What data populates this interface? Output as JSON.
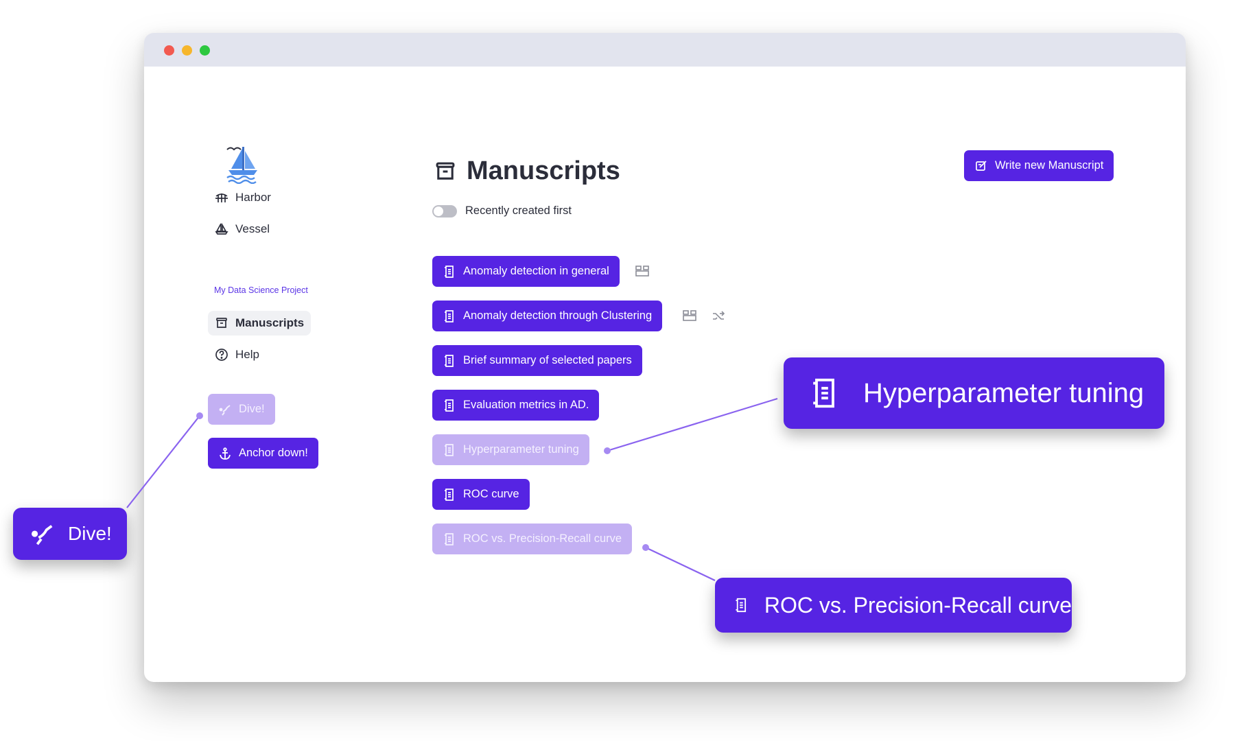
{
  "sidebar": {
    "nav": [
      {
        "label": "Harbor",
        "icon": "harbor-bridge-icon"
      },
      {
        "label": "Vessel",
        "icon": "sailboat-icon"
      }
    ],
    "project_label": "My Data Science Project",
    "nav2": [
      {
        "label": "Manuscripts",
        "icon": "archive-box-icon",
        "active": true
      },
      {
        "label": "Help",
        "icon": "question-circle-icon"
      }
    ],
    "dive_label": "Dive!",
    "anchor_label": "Anchor down!"
  },
  "header": {
    "title": "Manuscripts",
    "write_button_label": "Write new Manuscript",
    "toggle_label": "Recently created first",
    "toggle_on": false
  },
  "manuscripts": [
    {
      "label": "Anomaly detection in general",
      "state": "active",
      "extra_icons": [
        "layout-icon"
      ]
    },
    {
      "label": "Anomaly detection through Clustering",
      "state": "active",
      "extra_icons": [
        "layout-icon",
        "shuffle-icon"
      ]
    },
    {
      "label": "Brief summary of selected papers",
      "state": "active"
    },
    {
      "label": "Evaluation metrics in AD.",
      "state": "active"
    },
    {
      "label": "Hyperparameter tuning",
      "state": "faded"
    },
    {
      "label": "ROC curve",
      "state": "active"
    },
    {
      "label": "ROC vs. Precision-Recall curve",
      "state": "faded"
    }
  ],
  "callouts": {
    "dive": "Dive!",
    "hyperparameter": "Hyperparameter tuning",
    "roc_pr": "ROC vs. Precision-Recall curve"
  },
  "colors": {
    "accent": "#5624e3",
    "accent_faded": "#c3b0f3",
    "titlebar": "#e2e4ee",
    "text": "#2b2d3a",
    "connector": "#8a63ef"
  }
}
